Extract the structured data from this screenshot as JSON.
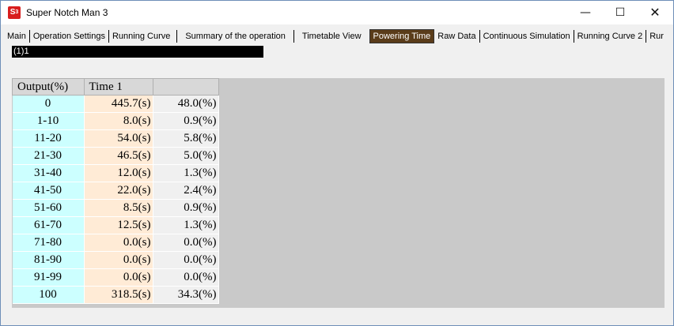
{
  "window": {
    "title": "Super Notch Man 3",
    "icon_text": "S",
    "icon_sub": "3",
    "minimize_glyph": "—",
    "maximize_glyph": "☐",
    "close_glyph": "✕"
  },
  "tabs": [
    {
      "label": "Main"
    },
    {
      "label": "Operation Settings"
    },
    {
      "label": "Running Curve"
    },
    {
      "label": "Summary of the operation"
    },
    {
      "label": "Timetable View"
    },
    {
      "label": "Powering Time",
      "active": true
    },
    {
      "label": "Raw Data"
    },
    {
      "label": "Continuous Simulation"
    },
    {
      "label": "Running Curve 2"
    },
    {
      "label": "Rur"
    }
  ],
  "selector": {
    "value": "(1)1"
  },
  "grid": {
    "headers": [
      "Output(%)",
      "Time 1",
      ""
    ],
    "rows": [
      [
        "0",
        "445.7(s)",
        "48.0(%)"
      ],
      [
        "1-10",
        "8.0(s)",
        "0.9(%)"
      ],
      [
        "11-20",
        "54.0(s)",
        "5.8(%)"
      ],
      [
        "21-30",
        "46.5(s)",
        "5.0(%)"
      ],
      [
        "31-40",
        "12.0(s)",
        "1.3(%)"
      ],
      [
        "41-50",
        "22.0(s)",
        "2.4(%)"
      ],
      [
        "51-60",
        "8.5(s)",
        "0.9(%)"
      ],
      [
        "61-70",
        "12.5(s)",
        "1.3(%)"
      ],
      [
        "71-80",
        "0.0(s)",
        "0.0(%)"
      ],
      [
        "81-90",
        "0.0(s)",
        "0.0(%)"
      ],
      [
        "91-99",
        "0.0(s)",
        "0.0(%)"
      ],
      [
        "100",
        "318.5(s)",
        "34.3(%)"
      ]
    ]
  }
}
